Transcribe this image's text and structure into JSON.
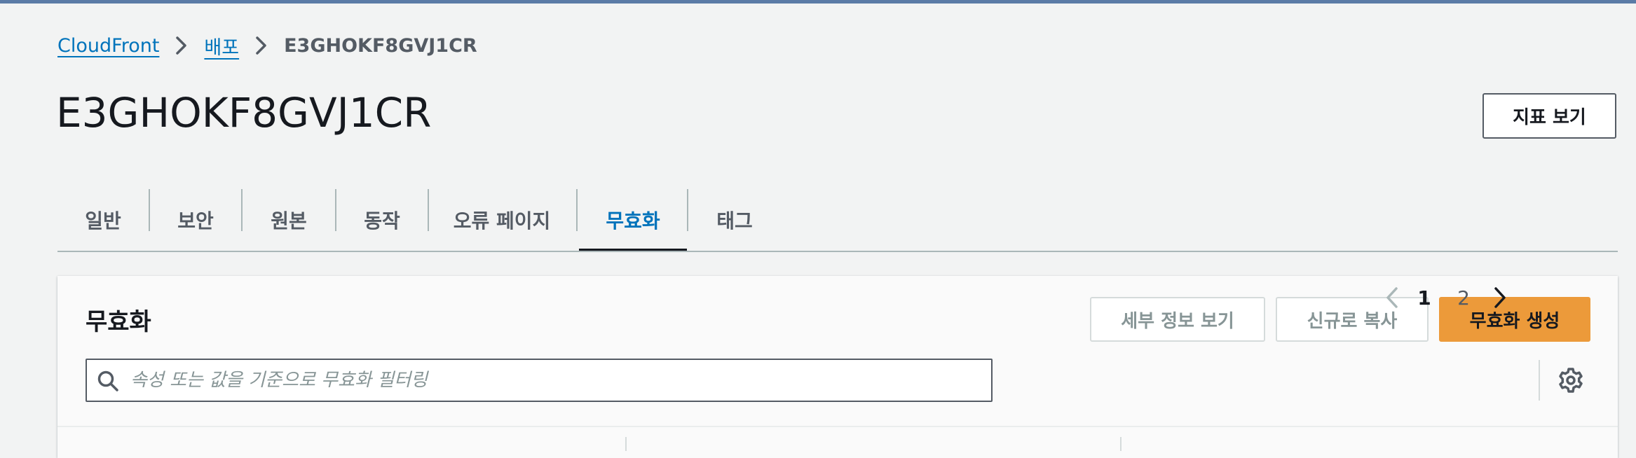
{
  "breadcrumb": {
    "items": [
      {
        "label": "CloudFront",
        "link": true
      },
      {
        "label": "배포",
        "link": true
      },
      {
        "label": "E3GHOKF8GVJ1CR",
        "link": false
      }
    ]
  },
  "page": {
    "title": "E3GHOKF8GVJ1CR",
    "metrics_button": "지표 보기"
  },
  "tabs": [
    {
      "label": "일반",
      "active": false
    },
    {
      "label": "보안",
      "active": false
    },
    {
      "label": "원본",
      "active": false
    },
    {
      "label": "동작",
      "active": false
    },
    {
      "label": "오류 페이지",
      "active": false
    },
    {
      "label": "무효화",
      "active": true
    },
    {
      "label": "태그",
      "active": false
    }
  ],
  "invalidations": {
    "title": "무효화",
    "details_button": "세부 정보 보기",
    "copy_button": "신규로 복사",
    "create_button": "무효화 생성",
    "search": {
      "placeholder": "속성 또는 값을 기준으로 무효화 필터링",
      "value": ""
    },
    "pagination": {
      "current": "1",
      "next": "2"
    }
  },
  "icons": {
    "breadcrumb_separator": "chevron-right-icon",
    "search": "search-icon",
    "previous_page": "chevron-left-icon",
    "next_page": "chevron-right-icon",
    "settings": "gear-icon"
  },
  "colors": {
    "link": "#0073bb",
    "primary_button": "#ec9a3a",
    "background": "#f2f3f3",
    "top_bar": "#5b7ba6"
  }
}
